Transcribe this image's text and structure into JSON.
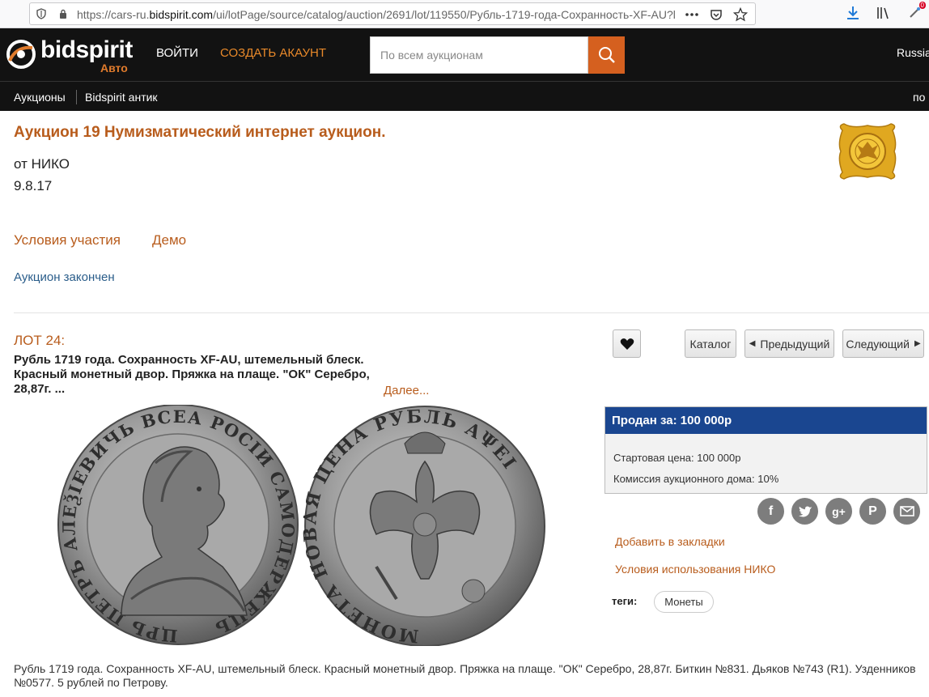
{
  "browser": {
    "url_prefix": "https://cars-ru.",
    "url_domain": "bidspirit.com",
    "url_rest": "/ui/lotPage/source/catalog/auction/2691/lot/119550/Рубль-1719-года-Сохранность-XF-AU?l",
    "badge": "0"
  },
  "header": {
    "logo_text": "bidspirit",
    "logo_sub": "Авто",
    "login": "ВОЙТИ",
    "create_account": "СОЗДАТЬ АКАУНТ",
    "search_placeholder": "По всем аукционам",
    "language": "Russia"
  },
  "subnav": {
    "auctions": "Аукционы",
    "antique": "Bidspirit антик",
    "right": "по"
  },
  "auction": {
    "title": "Аукцион 19 Нумизматический интернет аукцион.",
    "from": "от НИКО",
    "date": "9.8.17",
    "terms": "Условия участия",
    "demo": "Демо",
    "status": "Аукцион закончен"
  },
  "lot": {
    "number": "ЛОТ 24:",
    "title": "Рубль 1719 года. Сохранность XF-AU, штемельный блеск. Красный монетный двор. Пряжка на плаще. \"ОК\" Серебро, 28,87г. ...",
    "more": "Далее...",
    "coin_obverse_legend": "ЦРЬ ПЕТРЪ АЛЕѮIЕВИЧЬ ВСЕА РОСIИ САМОДЕРЖЕЦЬ",
    "coin_reverse_legend": "МОНЕТА НОВАЯ ЦЕНА РУБЛЬ АΨЕI",
    "description": "Рубль 1719 года. Сохранность XF-AU, штемельный блеск. Красный монетный двор. Пряжка на плаще. \"ОК\" Серебро, 28,87г. Биткин №831. Дьяков №743 (R1). Узденников №0577. 5 рублей по Петрову."
  },
  "buttons": {
    "catalog": "Каталог",
    "prev": "Предыдущий",
    "next": "Следующий"
  },
  "price": {
    "sold": "Продан за: 100 000р",
    "start_label": "Стартовая цена:",
    "start_value": "100 000р",
    "commission_label": "Комиссия аукционного дома:",
    "commission_value": "10%"
  },
  "social": [
    "facebook-icon",
    "twitter-icon",
    "google-plus-icon",
    "pinterest-icon",
    "email-icon"
  ],
  "side": {
    "bookmarks": "Добавить в закладки",
    "terms_niko": "Условия использования НИКО",
    "tags_label": "теги:",
    "tag": "Монеты"
  },
  "colors": {
    "accent": "#b85c1c",
    "header_bg": "#121212",
    "search_button": "#d5601f",
    "sold_bar": "#1a4690"
  }
}
